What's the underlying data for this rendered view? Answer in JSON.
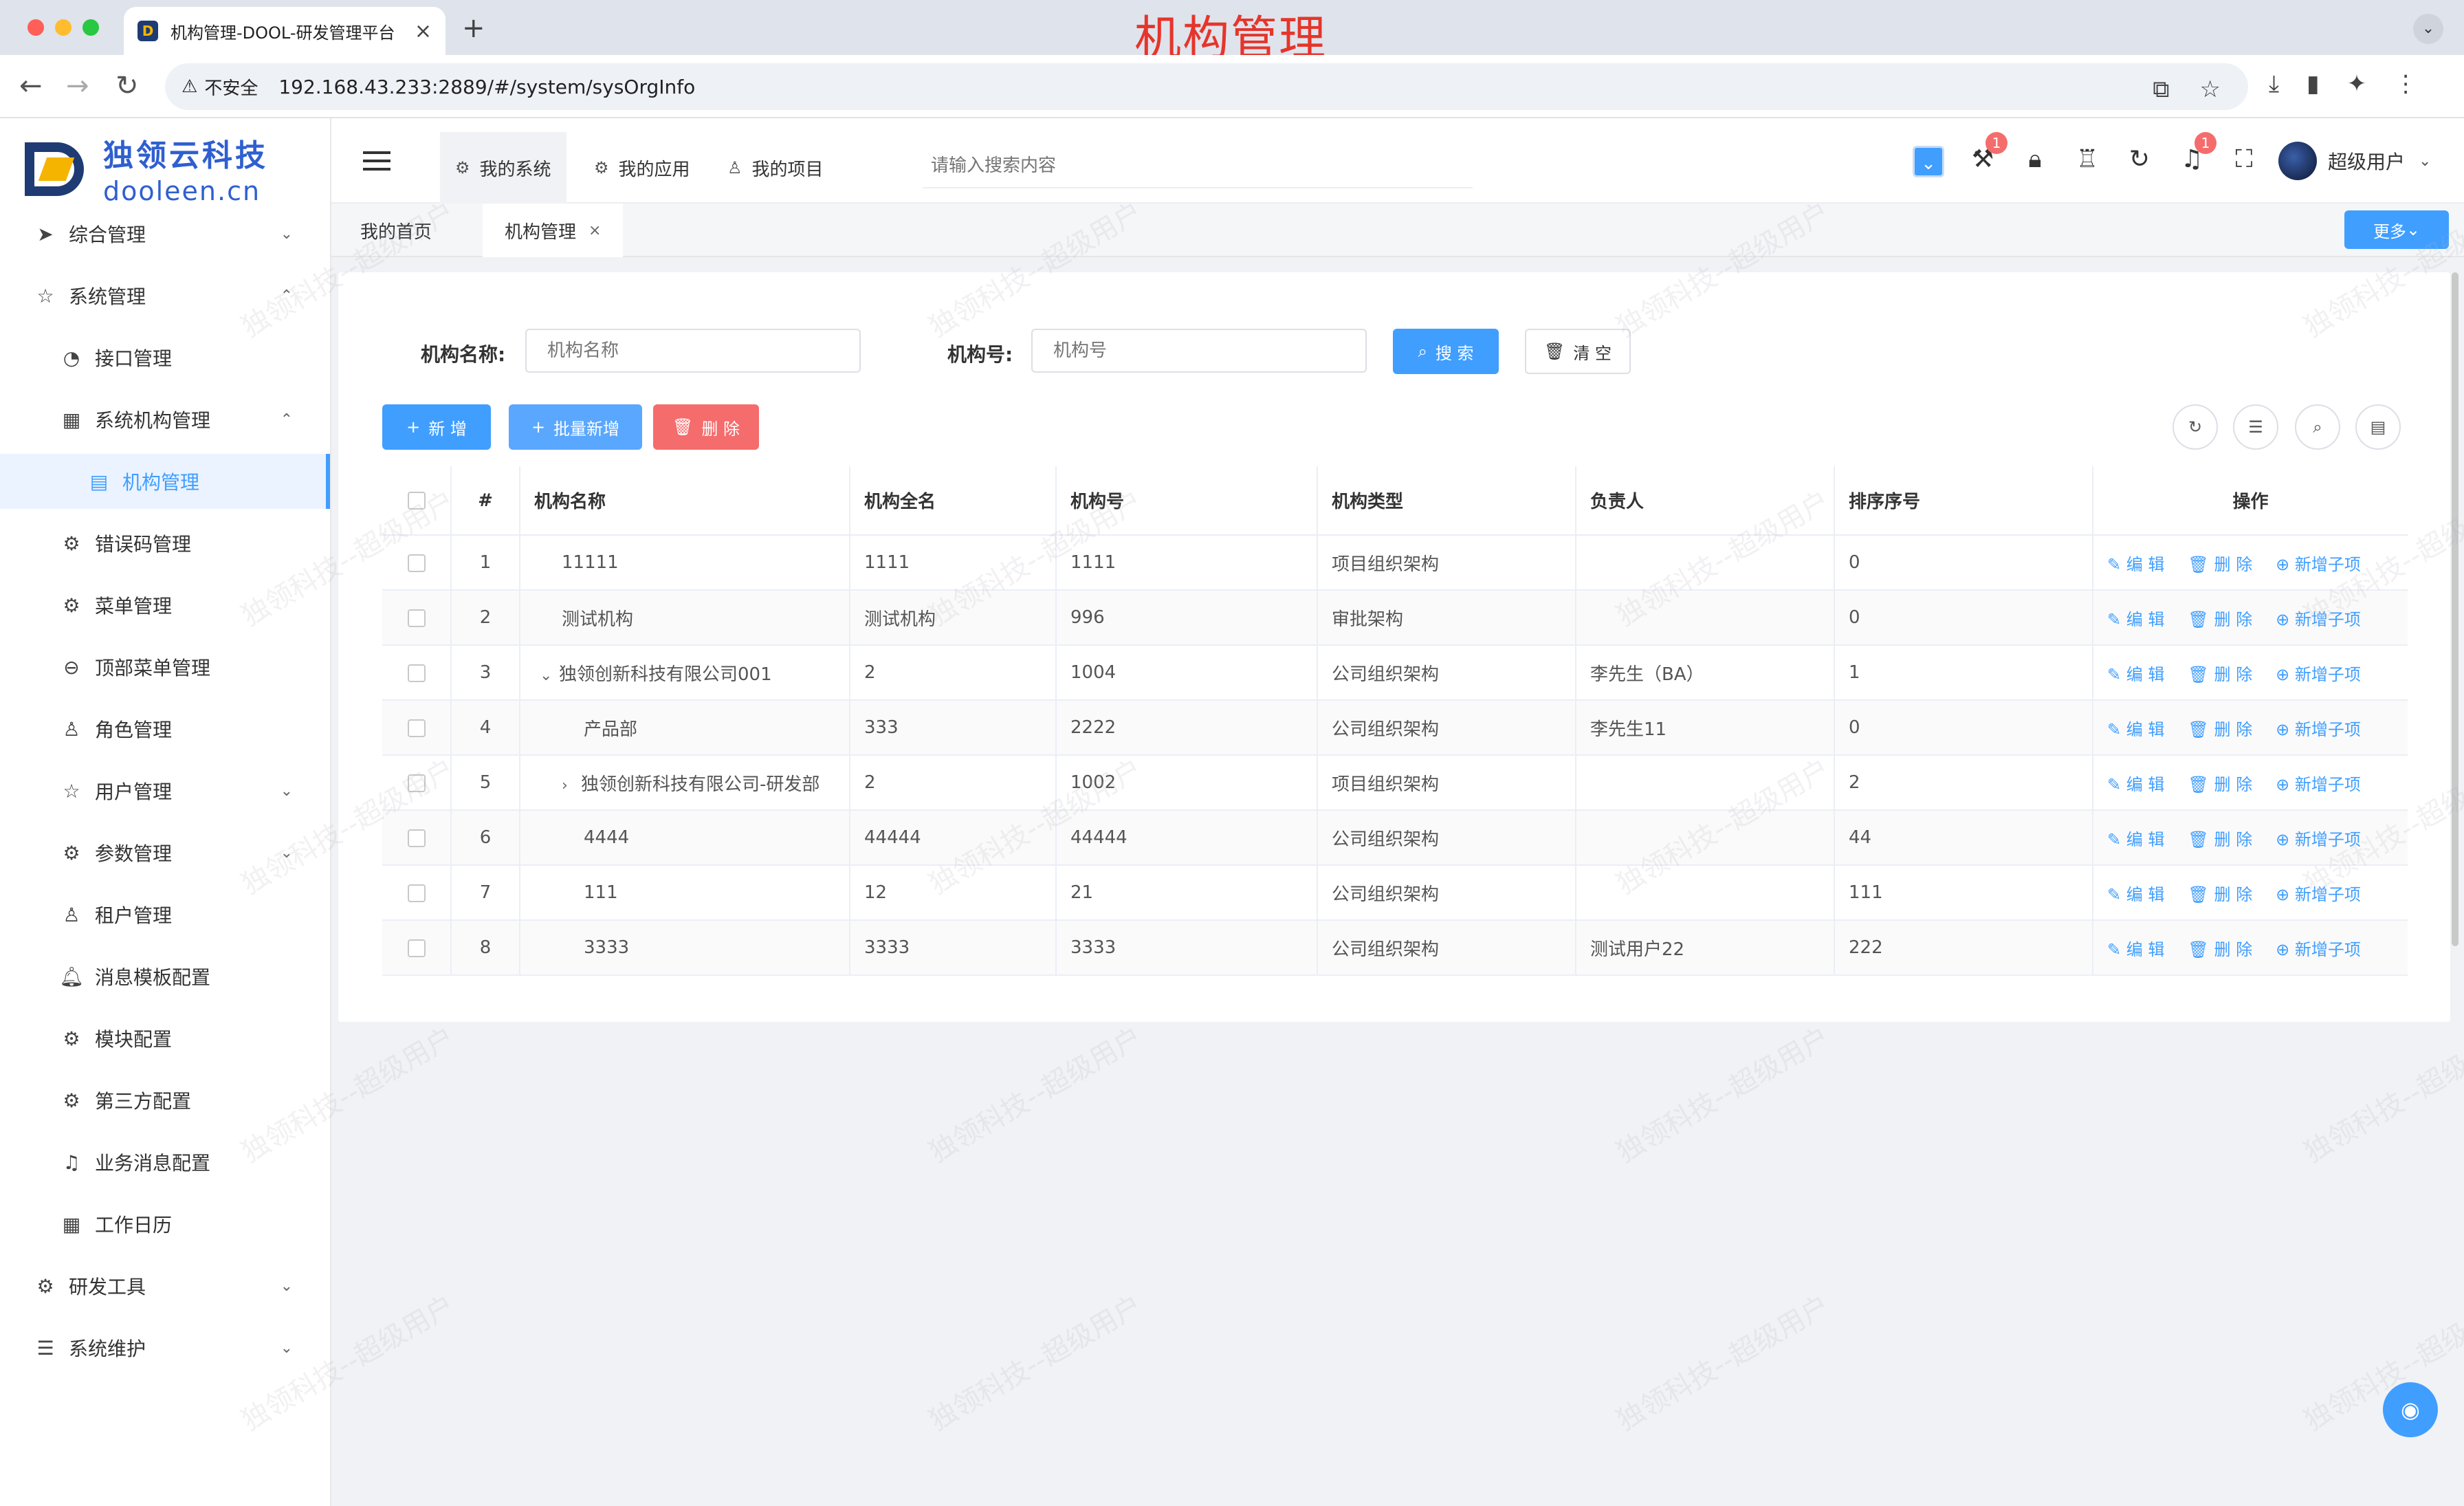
{
  "browser": {
    "tab_title": "机构管理-DOOL-研发管理平台",
    "overlay_title": "机构管理",
    "insecure_label": "不安全",
    "url": "192.168.43.233:2889/#/system/sysOrgInfo"
  },
  "logo": {
    "cn": "独领云科技",
    "en": "dooleen.cn"
  },
  "sidebar": {
    "items": [
      {
        "label": "综合管理",
        "icon": "paper-plane-icon"
      },
      {
        "label": "系统管理",
        "icon": "star-icon"
      },
      {
        "label": "接口管理",
        "icon": "gauge-icon"
      },
      {
        "label": "系统机构管理",
        "icon": "grid-icon"
      },
      {
        "label": "机构管理",
        "icon": "document-icon"
      },
      {
        "label": "错误码管理",
        "icon": "gear-icon"
      },
      {
        "label": "菜单管理",
        "icon": "gear-icon"
      },
      {
        "label": "顶部菜单管理",
        "icon": "search-circle-icon"
      },
      {
        "label": "角色管理",
        "icon": "user-icon"
      },
      {
        "label": "用户管理",
        "icon": "star-icon"
      },
      {
        "label": "参数管理",
        "icon": "gear-icon"
      },
      {
        "label": "租户管理",
        "icon": "user-icon"
      },
      {
        "label": "消息模板配置",
        "icon": "bell-icon"
      },
      {
        "label": "模块配置",
        "icon": "gear-icon"
      },
      {
        "label": "第三方配置",
        "icon": "gear-icon"
      },
      {
        "label": "业务消息配置",
        "icon": "bell-icon"
      },
      {
        "label": "工作日历",
        "icon": "calendar-icon"
      },
      {
        "label": "研发工具",
        "icon": "gear-icon"
      },
      {
        "label": "系统维护",
        "icon": "sliders-icon"
      }
    ]
  },
  "header": {
    "tabs": [
      {
        "label": "我的系统"
      },
      {
        "label": "我的应用"
      },
      {
        "label": "我的项目"
      }
    ],
    "search_placeholder": "请输入搜索内容",
    "badge_tools": "1",
    "badge_bell": "1",
    "username": "超级用户"
  },
  "tagbar": {
    "home": "我的首页",
    "current": "机构管理",
    "more": "更多"
  },
  "form": {
    "name_label": "机构名称:",
    "name_placeholder": "机构名称",
    "code_label": "机构号:",
    "code_placeholder": "机构号",
    "search_btn": "搜 索",
    "clear_btn": "清 空"
  },
  "actions": {
    "add": "新 增",
    "batch_add": "批量新增",
    "delete": "删 除"
  },
  "table": {
    "headers": [
      "#",
      "机构名称",
      "机构全名",
      "机构号",
      "机构类型",
      "负责人",
      "排序序号",
      "操作"
    ],
    "op_edit": "编 辑",
    "op_delete": "删 除",
    "op_add_child": "新增子项",
    "rows": [
      {
        "idx": "1",
        "name": "11111",
        "fullname": "1111",
        "code": "1111",
        "type": "项目组织架构",
        "owner": "",
        "sort": "0"
      },
      {
        "idx": "2",
        "name": "测试机构",
        "fullname": "测试机构",
        "code": "996",
        "type": "审批架构",
        "owner": "",
        "sort": "0"
      },
      {
        "idx": "3",
        "name": "独领创新科技有限公司001",
        "fullname": "2",
        "code": "1004",
        "type": "公司组织架构",
        "owner": "李先生（BA）",
        "sort": "1"
      },
      {
        "idx": "4",
        "name": "产品部",
        "fullname": "333",
        "code": "2222",
        "type": "公司组织架构",
        "owner": "李先生11",
        "sort": "0"
      },
      {
        "idx": "5",
        "name": "独领创新科技有限公司-研发部",
        "fullname": "2",
        "code": "1002",
        "type": "项目组织架构",
        "owner": "",
        "sort": "2"
      },
      {
        "idx": "6",
        "name": "4444",
        "fullname": "44444",
        "code": "44444",
        "type": "公司组织架构",
        "owner": "",
        "sort": "44"
      },
      {
        "idx": "7",
        "name": "111",
        "fullname": "12",
        "code": "21",
        "type": "公司组织架构",
        "owner": "",
        "sort": "111"
      },
      {
        "idx": "8",
        "name": "3333",
        "fullname": "3333",
        "code": "3333",
        "type": "公司组织架构",
        "owner": "测试用户22",
        "sort": "222"
      }
    ]
  },
  "watermark": "独领科技--超级用户",
  "colors": {
    "primary": "#409eff",
    "danger": "#f56c6c",
    "overlay_title": "#e5352b"
  }
}
